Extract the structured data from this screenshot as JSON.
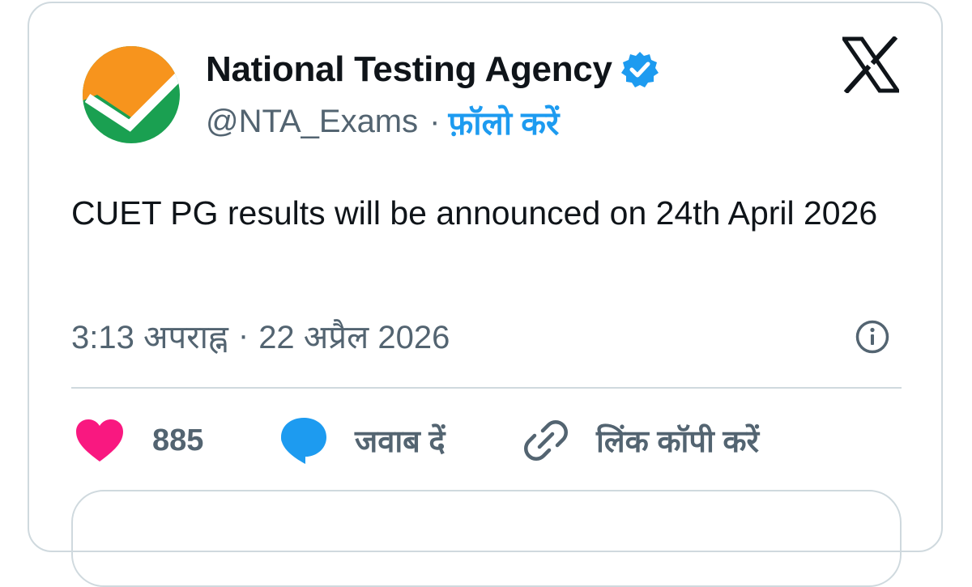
{
  "colors": {
    "accent": "#1d9bf0",
    "like": "#f91880",
    "text_primary": "#0f1419",
    "text_secondary": "#536471",
    "border": "#cfd9de",
    "logo_orange": "#f7941d",
    "logo_green": "#1aa051"
  },
  "author": {
    "display_name": "National Testing Agency",
    "handle": "@NTA_Exams",
    "separator": "·",
    "follow_label": "फ़ॉलो करें",
    "avatar_icon": "nta-logo-icon",
    "verified_icon": "verified-badge-icon"
  },
  "platform": {
    "logo_icon": "x-logo-icon"
  },
  "tweet": {
    "text": "CUET PG results will be announced on 24th April 2026",
    "time": "3:13 अपराह्न",
    "separator": "·",
    "date": "22 अप्रैल 2026",
    "info_icon": "info-icon"
  },
  "actions": {
    "like_count": "885",
    "like_icon": "heart-icon",
    "reply_label": "जवाब दें",
    "reply_icon": "speech-bubble-icon",
    "copy_link_label": "लिंक कॉपी करें",
    "copy_link_icon": "link-icon"
  }
}
